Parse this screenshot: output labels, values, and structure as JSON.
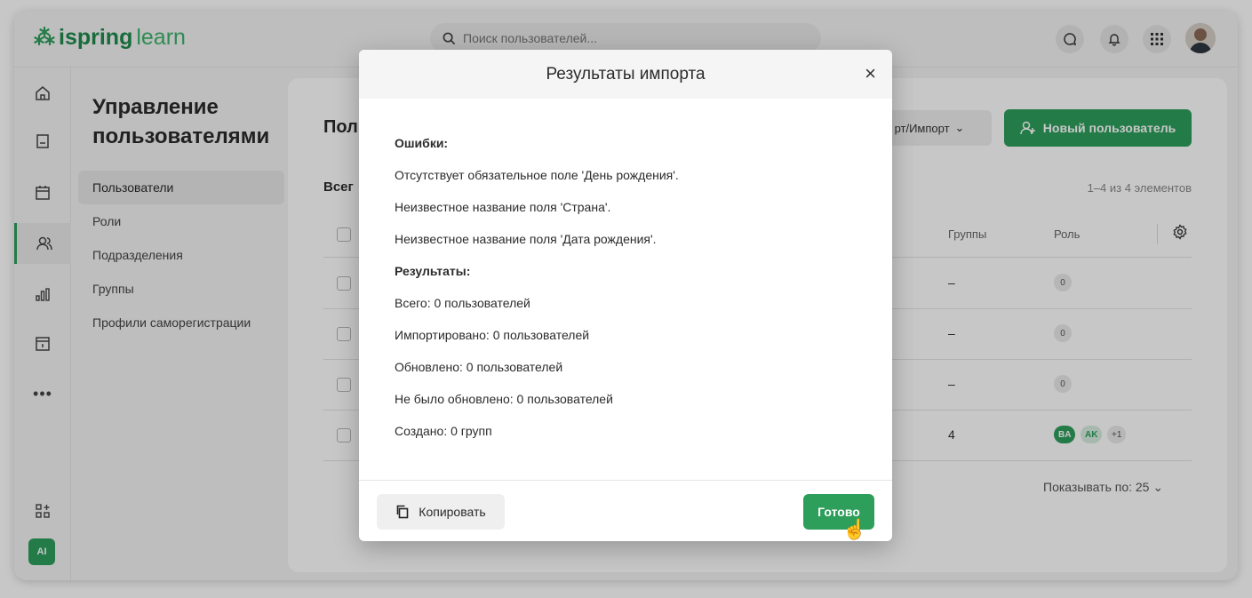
{
  "brand": {
    "part1": "ispring",
    "part2": "learn",
    "color": "#2e9e5b"
  },
  "search": {
    "placeholder": "Поиск пользователей..."
  },
  "subnav": {
    "title": "Управление пользователями",
    "items": [
      {
        "label": "Пользователи",
        "active": true
      },
      {
        "label": "Роли"
      },
      {
        "label": "Подразделения"
      },
      {
        "label": "Группы"
      },
      {
        "label": "Профили саморегистрации"
      }
    ]
  },
  "content": {
    "title": "Пол",
    "total": "Всег",
    "export_import": "рт/Импорт",
    "new_user": "Новый пользователь",
    "count": "1–4 из 4 элементов",
    "columns": {
      "groups": "Группы",
      "role": "Роль"
    },
    "rows": [
      {
        "groups": "–",
        "roles": [
          "0"
        ]
      },
      {
        "groups": "–",
        "roles": [
          "0"
        ]
      },
      {
        "groups": "–",
        "roles": [
          "0"
        ]
      },
      {
        "groups": "4",
        "roles": [
          "BA",
          "AK",
          "+1"
        ]
      }
    ],
    "per_page": "Показывать по: 25"
  },
  "rail": {
    "ai_label": "AI"
  },
  "modal": {
    "title": "Результаты импорта",
    "errors_heading": "Ошибки:",
    "errors": [
      "Отсутствует обязательное поле 'День рождения'.",
      "Неизвестное название поля 'Страна'.",
      "Неизвестное название поля 'Дата рождения'."
    ],
    "results_heading": "Результаты:",
    "results": [
      "Всего: 0 пользователей",
      "Импортировано: 0 пользователей",
      "Обновлено: 0 пользователей",
      "Не было обновлено: 0 пользователей",
      "Создано: 0 групп"
    ],
    "copy_label": "Копировать",
    "done_label": "Готово"
  },
  "colors": {
    "accent": "#2e9e5b",
    "overlay": "rgba(0,0,0,0.22)"
  }
}
